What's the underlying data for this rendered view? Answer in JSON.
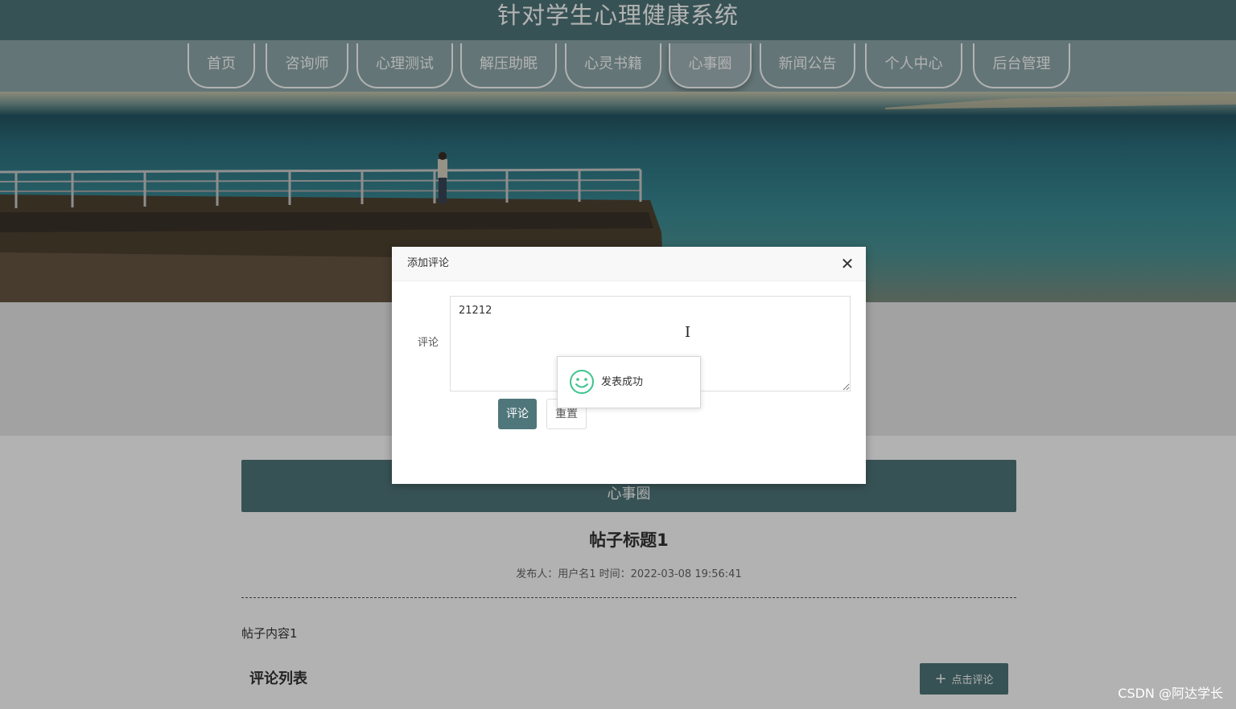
{
  "header": {
    "site_title": "针对学生心理健康系统"
  },
  "nav": {
    "items": [
      {
        "label": "首页"
      },
      {
        "label": "咨询师"
      },
      {
        "label": "心理测试"
      },
      {
        "label": "解压助眠"
      },
      {
        "label": "心灵书籍"
      },
      {
        "label": "心事圈",
        "active": true
      },
      {
        "label": "新闻公告"
      },
      {
        "label": "个人中心"
      },
      {
        "label": "后台管理"
      }
    ]
  },
  "main": {
    "section_title": "心事圈",
    "post_title": "帖子标题1",
    "post_meta": "发布人：用户名1 时间：2022-03-08 19:56:41",
    "post_content": "帖子内容1",
    "comment_list_title": "评论列表",
    "add_comment_button": "点击评论"
  },
  "modal": {
    "title": "添加评论",
    "field_label": "评论",
    "comment_value": "21212",
    "submit_label": "评论",
    "reset_label": "重置"
  },
  "toast": {
    "message": "发表成功",
    "icon": "smile-icon",
    "icon_color": "#3cc48d"
  },
  "watermark": "CSDN @阿达学长",
  "colors": {
    "theme": "#4f767a",
    "nav_bg": "#8fa8ab"
  }
}
